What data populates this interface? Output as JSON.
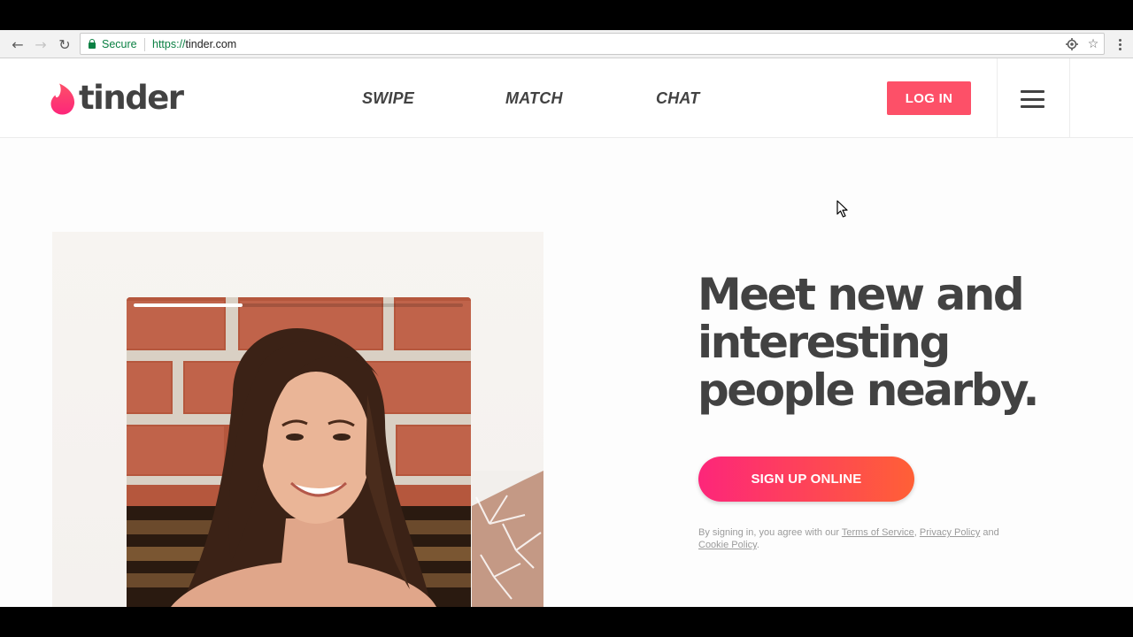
{
  "browser": {
    "secure_label": "Secure",
    "url_scheme": "https://",
    "url_host": "tinder.com",
    "icons": [
      "back-arrow-icon",
      "forward-arrow-icon",
      "reload-icon",
      "lock-icon",
      "location-icon",
      "star-icon",
      "menu-dots-icon"
    ]
  },
  "header": {
    "logo_text": "tinder",
    "nav": [
      "SWIPE",
      "MATCH",
      "CHAT"
    ],
    "login_label": "LOG IN"
  },
  "hero": {
    "headline_lines": [
      "Meet new and",
      "interesting",
      "people nearby."
    ],
    "signup_label": "SIGN UP ONLINE",
    "progress_fraction": 0.33,
    "legal": {
      "prefix": "By signing in, you agree with our ",
      "terms": "Terms of Service",
      "comma": ", ",
      "privacy": "Privacy Policy",
      "and": " and",
      "cookie": "Cookie Policy",
      "suffix": "."
    }
  },
  "colors": {
    "brand": "#fd5068",
    "gradient_start": "#fd267a",
    "gradient_end": "#ff6036",
    "text_dark": "#424242",
    "secure_green": "#0b8043"
  }
}
